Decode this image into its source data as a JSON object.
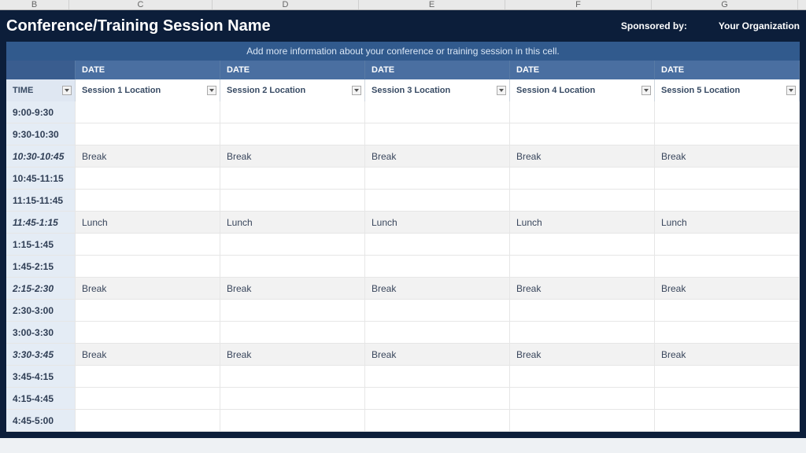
{
  "ruler": {
    "cols": [
      "B",
      "C",
      "D",
      "E",
      "F",
      "G"
    ],
    "widths": [
      88,
      182,
      186,
      186,
      186,
      186
    ]
  },
  "header": {
    "title": "Conference/Training Session Name",
    "sponsored_label": "Sponsored by:",
    "org": "Your Organization"
  },
  "info_text": "Add more information about your conference or training session in this cell.",
  "date_header": {
    "time_label": "",
    "dates": [
      "DATE",
      "DATE",
      "DATE",
      "DATE",
      "DATE"
    ]
  },
  "loc_header": {
    "time_label": "TIME",
    "locations": [
      "Session 1 Location",
      "Session 2 Location",
      "Session 3 Location",
      "Session 4 Location",
      "Session 5 Location"
    ]
  },
  "rows": [
    {
      "time": "9:00-9:30",
      "cells": [
        "",
        "",
        "",
        "",
        ""
      ],
      "special": false
    },
    {
      "time": "9:30-10:30",
      "cells": [
        "",
        "",
        "",
        "",
        ""
      ],
      "special": false
    },
    {
      "time": "10:30-10:45",
      "cells": [
        "Break",
        "Break",
        "Break",
        "Break",
        "Break"
      ],
      "special": true
    },
    {
      "time": "10:45-11:15",
      "cells": [
        "",
        "",
        "",
        "",
        ""
      ],
      "special": false
    },
    {
      "time": "11:15-11:45",
      "cells": [
        "",
        "",
        "",
        "",
        ""
      ],
      "special": false
    },
    {
      "time": "11:45-1:15",
      "cells": [
        "Lunch",
        "Lunch",
        "Lunch",
        "Lunch",
        "Lunch"
      ],
      "special": true
    },
    {
      "time": "1:15-1:45",
      "cells": [
        "",
        "",
        "",
        "",
        ""
      ],
      "special": false
    },
    {
      "time": "1:45-2:15",
      "cells": [
        "",
        "",
        "",
        "",
        ""
      ],
      "special": false
    },
    {
      "time": "2:15-2:30",
      "cells": [
        "Break",
        "Break",
        "Break",
        "Break",
        "Break"
      ],
      "special": true
    },
    {
      "time": "2:30-3:00",
      "cells": [
        "",
        "",
        "",
        "",
        ""
      ],
      "special": false
    },
    {
      "time": "3:00-3:30",
      "cells": [
        "",
        "",
        "",
        "",
        ""
      ],
      "special": false
    },
    {
      "time": "3:30-3:45",
      "cells": [
        "Break",
        "Break",
        "Break",
        "Break",
        "Break"
      ],
      "special": true
    },
    {
      "time": "3:45-4:15",
      "cells": [
        "",
        "",
        "",
        "",
        ""
      ],
      "special": false
    },
    {
      "time": "4:15-4:45",
      "cells": [
        "",
        "",
        "",
        "",
        ""
      ],
      "special": false
    },
    {
      "time": "4:45-5:00",
      "cells": [
        "",
        "",
        "",
        "",
        ""
      ],
      "special": false
    }
  ]
}
